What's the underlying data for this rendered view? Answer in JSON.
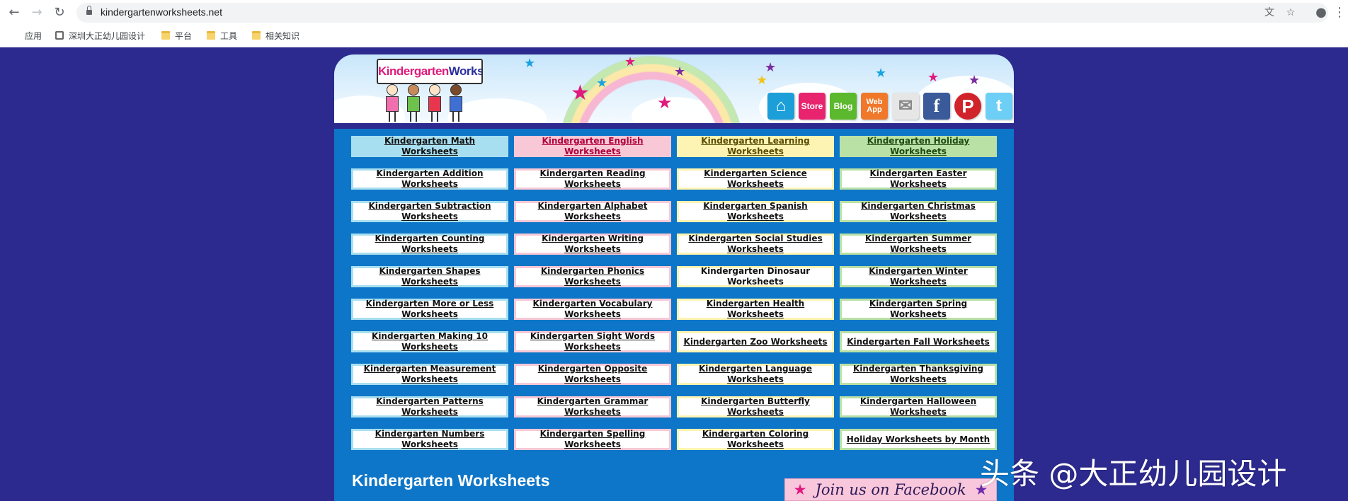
{
  "browser": {
    "url": "kindergartenworksheets.net",
    "bookmarks": [
      {
        "label": "应用",
        "icon": "apps-grid-icon"
      },
      {
        "label": "深圳大正幼儿园设计",
        "icon": "site-icon"
      },
      {
        "label": "平台",
        "icon": "folder-icon"
      },
      {
        "label": "工具",
        "icon": "folder-icon"
      },
      {
        "label": "相关知识",
        "icon": "folder-icon"
      }
    ]
  },
  "header": {
    "logo_text_pink": "Kindergarten",
    "logo_text_blue": "Worksheets",
    "social_icons": [
      {
        "name": "home",
        "label": "",
        "color": "#1c9fd8"
      },
      {
        "name": "store",
        "label": "Store",
        "color": "#e8246f"
      },
      {
        "name": "blog",
        "label": "Blog",
        "color": "#5cb82c"
      },
      {
        "name": "webapp",
        "label": "Web App",
        "color": "#f0782a"
      },
      {
        "name": "email",
        "label": "",
        "color": "#d9d9d9"
      },
      {
        "name": "facebook",
        "label": "f",
        "color": "#3b5a9a"
      },
      {
        "name": "pinterest",
        "label": "P",
        "color": "#d1232a"
      },
      {
        "name": "twitter",
        "label": "t",
        "color": "#6dcff6"
      }
    ]
  },
  "columns": {
    "headers": [
      "Kindergarten Math Worksheets",
      "Kindergarten English Worksheets",
      "Kindergarten Learning Worksheets",
      "Kindergarten Holiday Worksheets"
    ],
    "math": [
      "Kindergarten Addition Worksheets",
      "Kindergarten Subtraction Worksheets",
      "Kindergarten Counting Worksheets",
      "Kindergarten Shapes Worksheets",
      "Kindergarten More or Less Worksheets",
      "Kindergarten Making 10 Worksheets",
      "Kindergarten Measurement Worksheets",
      "Kindergarten Patterns Worksheets",
      "Kindergarten Numbers Worksheets"
    ],
    "english": [
      "Kindergarten Reading Worksheets",
      "Kindergarten Alphabet Worksheets",
      "Kindergarten Writing Worksheets",
      "Kindergarten Phonics Worksheets",
      "Kindergarten Vocabulary Worksheets",
      "Kindergarten Sight Words Worksheets",
      "Kindergarten Opposite Worksheets",
      "Kindergarten Grammar Worksheets",
      "Kindergarten Spelling Worksheets"
    ],
    "learning": [
      "Kindergarten Science Worksheets",
      "Kindergarten Spanish Worksheets",
      "Kindergarten Social Studies Worksheets",
      "Kindergarten Dinosaur Worksheets",
      "Kindergarten Health Worksheets",
      "Kindergarten Zoo Worksheets",
      "Kindergarten Language Worksheets",
      "Kindergarten Butterfly Worksheets",
      "Kindergarten Coloring Worksheets"
    ],
    "holiday": [
      "Kindergarten Easter Worksheets",
      "Kindergarten Christmas Worksheets",
      "Kindergarten Summer Worksheets",
      "Kindergarten Winter Worksheets",
      "Kindergarten Spring Worksheets",
      "Kindergarten Fall Worksheets",
      "Kindergarten Thanksgiving Worksheets",
      "Kindergarten Halloween Worksheets",
      "Holiday Worksheets by Month"
    ]
  },
  "section_title": "Kindergarten Worksheets",
  "facebook_banner": "Join us on Facebook",
  "watermark": "头条 @大正幼儿园设计",
  "colors": {
    "page_bg": "#2c2a8f",
    "content_bg": "#0e76c8",
    "math": "#a8dff0",
    "english": "#f8c8d6",
    "learning": "#fdf4b3",
    "holiday": "#b9e0a5"
  }
}
